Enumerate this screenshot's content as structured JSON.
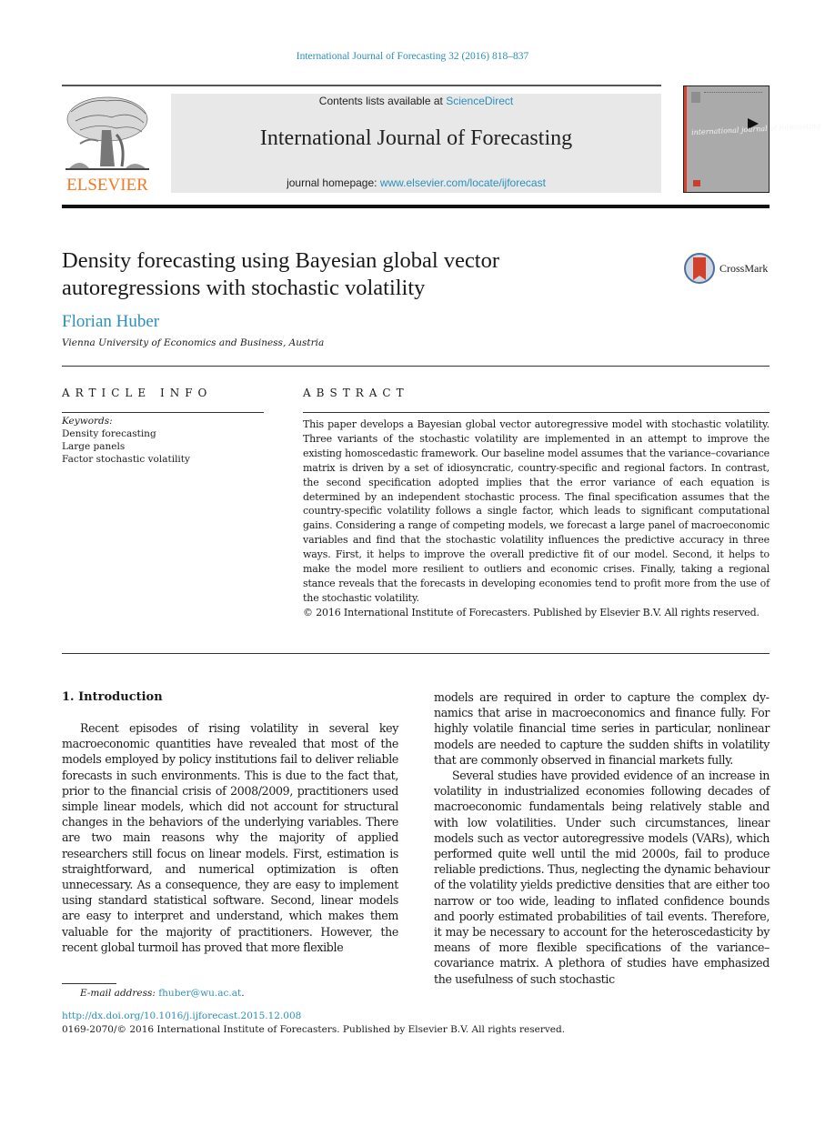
{
  "running_head": "International Journal of Forecasting 32 (2016) 818–837",
  "masthead": {
    "publisher_logo_text": "ELSEVIER",
    "contents_prefix": "Contents lists available at ",
    "contents_link": "ScienceDirect",
    "journal_title": "International Journal of Forecasting",
    "homepage_prefix": "journal homepage: ",
    "homepage_link": "www.elsevier.com/locate/ijforecast",
    "cover_script": "international journal of forecasting",
    "colors": {
      "publisher_orange": "#f47a20",
      "link_blue": "#2a8fbd",
      "masthead_gray": "#e8e8e8"
    }
  },
  "article": {
    "title_line1": "Density forecasting using Bayesian global vector",
    "title_line2": "autoregressions with stochastic volatility",
    "crossmark_label": "CrossMark",
    "author": "Florian Huber",
    "affiliation": "Vienna University of Economics and Business, Austria"
  },
  "article_info": {
    "heading": "ARTICLE INFO",
    "keywords_label": "Keywords:",
    "keywords": [
      "Density forecasting",
      "Large panels",
      "Factor stochastic volatility"
    ]
  },
  "abstract": {
    "heading": "ABSTRACT",
    "text": "This paper develops a Bayesian global vector autoregressive model with stochastic volatility. Three variants of the stochastic volatility are implemented in an attempt to improve the existing homoscedastic framework. Our baseline model assumes that the variance–covariance matrix is driven by a set of idiosyncratic, country-specific and regional factors. In contrast, the second specification adopted implies that the error variance of each equation is determined by an independent stochastic process. The final specification assumes that the country-specific volatility follows a single factor, which leads to significant computational gains. Considering a range of competing models, we forecast a large panel of macroeconomic variables and find that the stochastic volatility influences the predictive accuracy in three ways. First, it helps to improve the overall predictive fit of our model. Second, it helps to make the model more resilient to outliers and economic crises. Finally, taking a regional stance reveals that the forecasts in developing economies tend to profit more from the use of the stochastic volatility.",
    "copyright": "© 2016 International Institute of Forecasters. Published by Elsevier B.V. All rights reserved."
  },
  "body": {
    "section_heading": "1.  Introduction",
    "left_paragraph": "Recent episodes of rising volatility in several key macroeconomic quantities have revealed that most of the models employed by policy institutions fail to deliver re­liable forecasts in such environments. This is due to the fact that, prior to the financial crisis of 2008/2009, prac­titioners used simple linear models, which did not account for structural changes in the behaviors of the underlying variables. There are two main reasons why the majority of applied researchers still focus on linear models. First, es­timation is straightforward, and numerical optimization is often unnecessary. As a consequence, they are easy to im­plement using standard statistical software. Second, linear models are easy to interpret and understand, which makes them valuable for the majority of practitioners. However, the recent global turmoil has proved that more flexible",
    "right_paragraph_1": "models are required in order to capture the complex dy­namics that arise in macroeconomics and finance fully. For highly volatile financial time series in particular, non­linear models are needed to capture the sudden shifts in volatility that are commonly observed in financial markets fully.",
    "right_paragraph_2": "Several studies have provided evidence of an increase in volatility in industrialized economies following decades of macroeconomic fundamentals being relatively stable and with low volatilities. Under such circumstances, lin­ear models such as vector autoregressive models (VARs), which performed quite well until the mid 2000s, fail to produce reliable predictions. Thus, neglecting the dynamic behaviour of the volatility yields predictive densities that are either too narrow or too wide, leading to inflated confidence bounds and poorly estimated probabilities of tail events. Therefore, it may be necessary to account for the heteroscedasticity by means of more flexible specifi­cations of the variance–covariance matrix. A plethora of studies have emphasized the usefulness of such stochastic"
  },
  "footer": {
    "email_label": "E-mail address: ",
    "email": "fhuber@wu.ac.at",
    "email_suffix": ".",
    "doi": "http://dx.doi.org/10.1016/j.ijforecast.2015.12.008",
    "issn_line": "0169-2070/© 2016 International Institute of Forecasters. Published by Elsevier B.V. All rights reserved."
  }
}
